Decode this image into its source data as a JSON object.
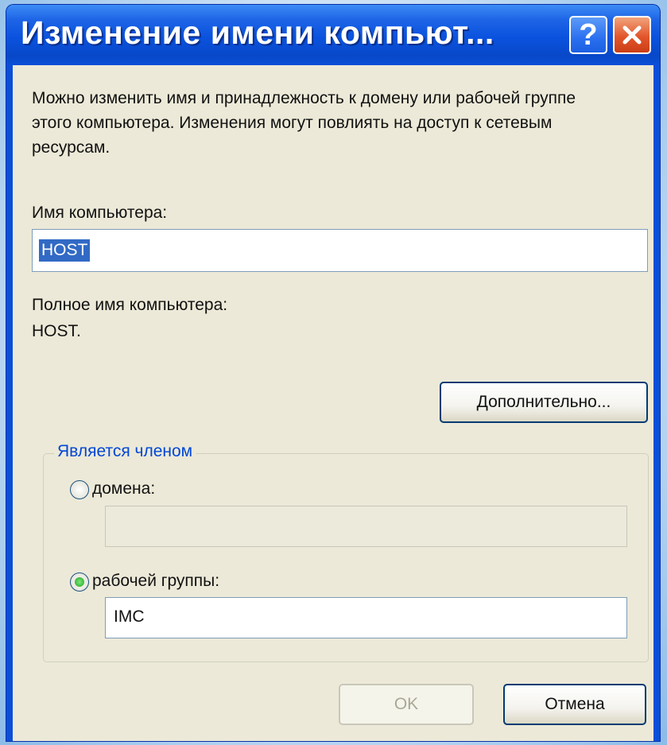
{
  "dialog": {
    "title": "Изменение имени компьют...",
    "help_glyph": "?",
    "intro_text": "Можно изменить имя и принадлежность к домену или рабочей группе этого компьютера. Изменения могут повлиять на доступ к сетевым ресурсам.",
    "computer_name_label": "Имя компьютера:",
    "computer_name_value": "HOST",
    "full_name_label": "Полное имя компьютера:",
    "full_name_value": "HOST.",
    "more_button": "Дополнительно...",
    "member_of": {
      "legend": "Является членом",
      "domain_label": "домена:",
      "domain_value": "",
      "domain_selected": false,
      "workgroup_label": "рабочей группы:",
      "workgroup_value": "IMC",
      "workgroup_selected": true
    },
    "ok_button": "OK",
    "cancel_button": "Отмена"
  },
  "colors": {
    "titlebar": "#0a52de",
    "dialog_bg": "#ece9d8",
    "selection": "#316ac5",
    "group_legend": "#0046d5",
    "close_button": "#e2562c"
  },
  "icons": {
    "help": "help-icon",
    "close": "close-icon"
  }
}
